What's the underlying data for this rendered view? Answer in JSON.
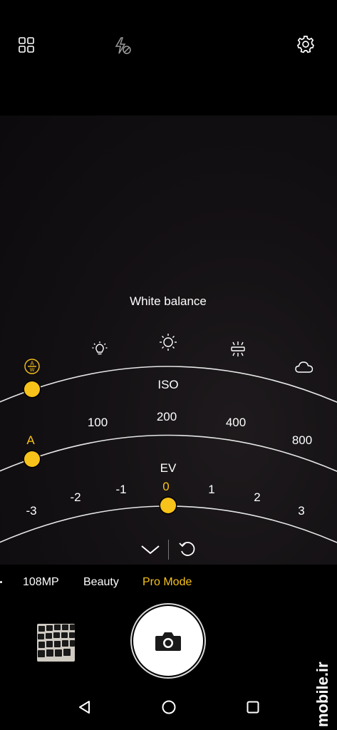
{
  "top_bar": {
    "grid_icon": "grid-icon",
    "flash_icon": "flash-off-icon",
    "settings_icon": "gear-icon"
  },
  "pro_controls": {
    "white_balance": {
      "title": "White balance",
      "auto_indicator": "A W",
      "presets": [
        "bulb-icon",
        "sun-icon",
        "fluorescent-icon",
        "cloud-icon"
      ]
    },
    "iso": {
      "title": "ISO",
      "auto_label": "A",
      "values": [
        "100",
        "200",
        "400",
        "800"
      ]
    },
    "ev": {
      "title": "EV",
      "values": [
        "-3",
        "-2",
        "-1",
        "0",
        "1",
        "2",
        "3"
      ],
      "selected": "0"
    },
    "collapse_icon": "chevron-down-icon",
    "reset_icon": "reset-icon"
  },
  "modes": {
    "items": [
      "108MP",
      "Beauty",
      "Pro Mode"
    ],
    "active": "Pro Mode"
  },
  "nav_bar": {
    "back_icon": "back-triangle-icon",
    "home_icon": "home-circle-icon",
    "recents_icon": "recents-square-icon"
  },
  "watermark": "mobile.ir",
  "colors": {
    "accent": "#f7c21a",
    "background": "#000000"
  }
}
